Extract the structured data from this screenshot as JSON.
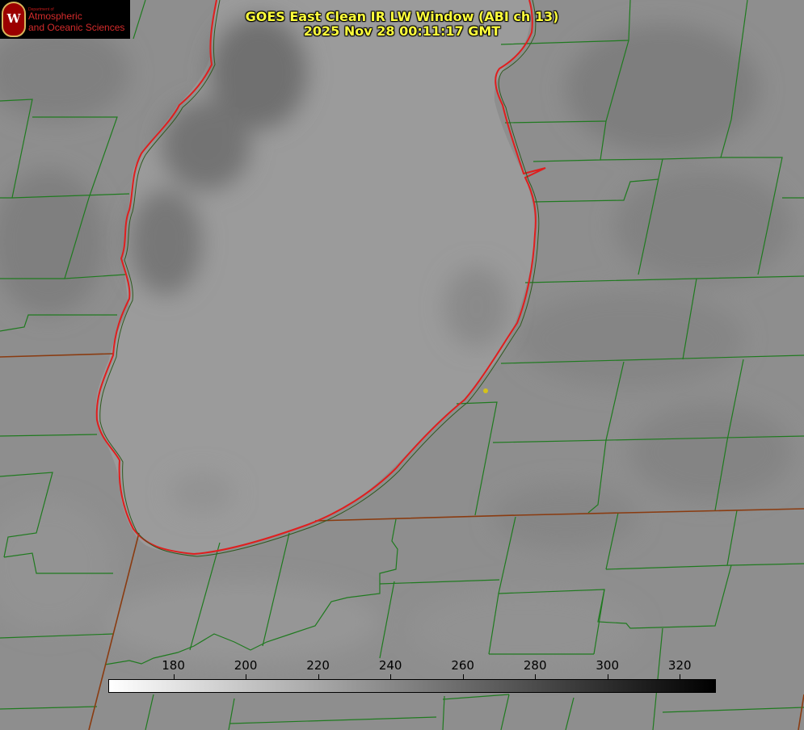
{
  "logo": {
    "department": "Department of",
    "line1": "Atmospheric",
    "line2": "and Oceanic Sciences",
    "seal_letter": "W",
    "seal_color": "#9b0000",
    "text_color": "#d42b2b"
  },
  "title": {
    "line1": "GOES East Clean IR LW Window (ABI ch 13)",
    "line2": "2025 Nov 28 00:11:17 GMT",
    "color": "#ffff3c"
  },
  "colorbar": {
    "ticks": [
      "180",
      "200",
      "220",
      "240",
      "260",
      "280",
      "300",
      "320"
    ],
    "min_value": 162,
    "max_value": 330,
    "gradient": [
      "#ffffff",
      "#000000"
    ]
  },
  "map_colors": {
    "county_lines": "#1f7a1f",
    "state_lines": "#8a3b10",
    "lake_coastline": "#e01e1e",
    "site_marker": "#d4c21a"
  },
  "icons": {
    "logo_seal": "uw-crest-icon",
    "site_marker": "station-dot-icon"
  }
}
